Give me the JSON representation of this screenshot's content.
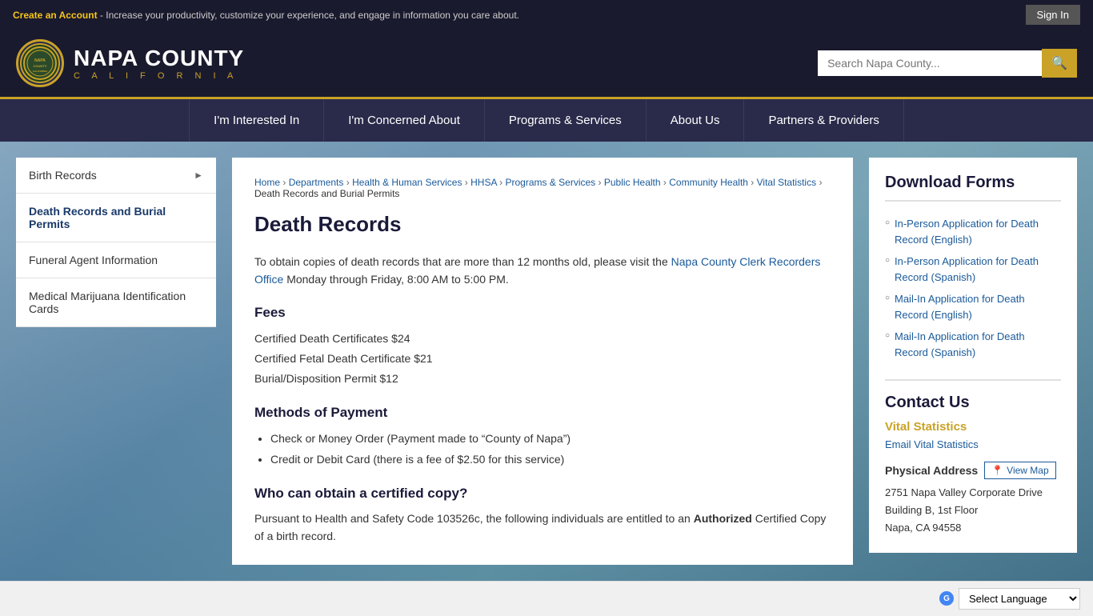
{
  "topBanner": {
    "linkText": "Create an Account",
    "bannerText": " - Increase your productivity, customize your experience, and engage in information you care about.",
    "signInLabel": "Sign In"
  },
  "header": {
    "logoCounty": "NAPA COUNTY",
    "logoState": "C A L I F O R N I A",
    "logoInner": "NAPA",
    "searchPlaceholder": "Search Napa County..."
  },
  "nav": {
    "items": [
      {
        "label": "I'm Interested In"
      },
      {
        "label": "I'm Concerned About"
      },
      {
        "label": "Programs & Services"
      },
      {
        "label": "About Us"
      },
      {
        "label": "Partners & Providers"
      }
    ]
  },
  "sidebar": {
    "items": [
      {
        "label": "Birth Records",
        "hasArrow": true,
        "active": false
      },
      {
        "label": "Death Records and Burial Permits",
        "hasArrow": false,
        "active": true
      },
      {
        "label": "Funeral Agent Information",
        "hasArrow": false,
        "active": false
      },
      {
        "label": "Medical Marijuana Identification Cards",
        "hasArrow": false,
        "active": false
      }
    ]
  },
  "breadcrumb": {
    "items": [
      {
        "label": "Home",
        "link": true
      },
      {
        "label": "Departments",
        "link": true
      },
      {
        "label": "Health & Human Services",
        "link": true
      },
      {
        "label": "HHSA",
        "link": true
      },
      {
        "label": "Programs & Services",
        "link": true
      },
      {
        "label": "Public Health",
        "link": true
      },
      {
        "label": "Community Health",
        "link": true
      },
      {
        "label": "Vital Statistics",
        "link": true
      },
      {
        "label": "Death Records and Burial Permits",
        "link": false
      }
    ]
  },
  "mainContent": {
    "pageTitle": "Death Records",
    "introText": "To obtain copies of death records that are more than 12 months old, please visit the ",
    "introLink": "Napa County Clerk Recorders Office",
    "introTextEnd": " Monday through Friday, 8:00 AM to 5:00 PM.",
    "feesHeading": "Fees",
    "fees": [
      "Certified Death Certificates $24",
      "Certified Fetal Death Certificate $21",
      "Burial/Disposition Permit $12"
    ],
    "paymentHeading": "Methods of Payment",
    "paymentItems": [
      "Check or Money Order (Payment made to “County of Napa”)",
      "Credit or Debit Card (there is a fee of $2.50 for this service)"
    ],
    "certifiedHeading": "Who can obtain a certified copy?",
    "certifiedText": "Pursuant to Health and Safety Code 103526c, the following individuals are entitled to an ",
    "certifiedBold": "Authorized",
    "certifiedTextEnd": " Certified Copy of a birth record."
  },
  "rightPanel": {
    "downloadTitle": "Download Forms",
    "downloadLinks": [
      {
        "label": "In-Person Application for Death Record (English)"
      },
      {
        "label": "In-Person Application for Death Record (Spanish)"
      },
      {
        "label": "Mail-In Application for Death Record (English)"
      },
      {
        "label": "Mail-In Application for Death Record (Spanish)"
      }
    ],
    "contactTitle": "Contact Us",
    "vitalStatsLabel": "Vital Statistics",
    "emailLabel": "Email Vital Statistics",
    "addressLabel": "Physical Address",
    "viewMapLabel": "View Map",
    "addressLine1": "2751 Napa Valley Corporate Drive",
    "addressLine2": "Building B, 1st Floor",
    "addressLine3": "Napa, CA 94558"
  },
  "translateBar": {
    "label": "Select Language"
  }
}
